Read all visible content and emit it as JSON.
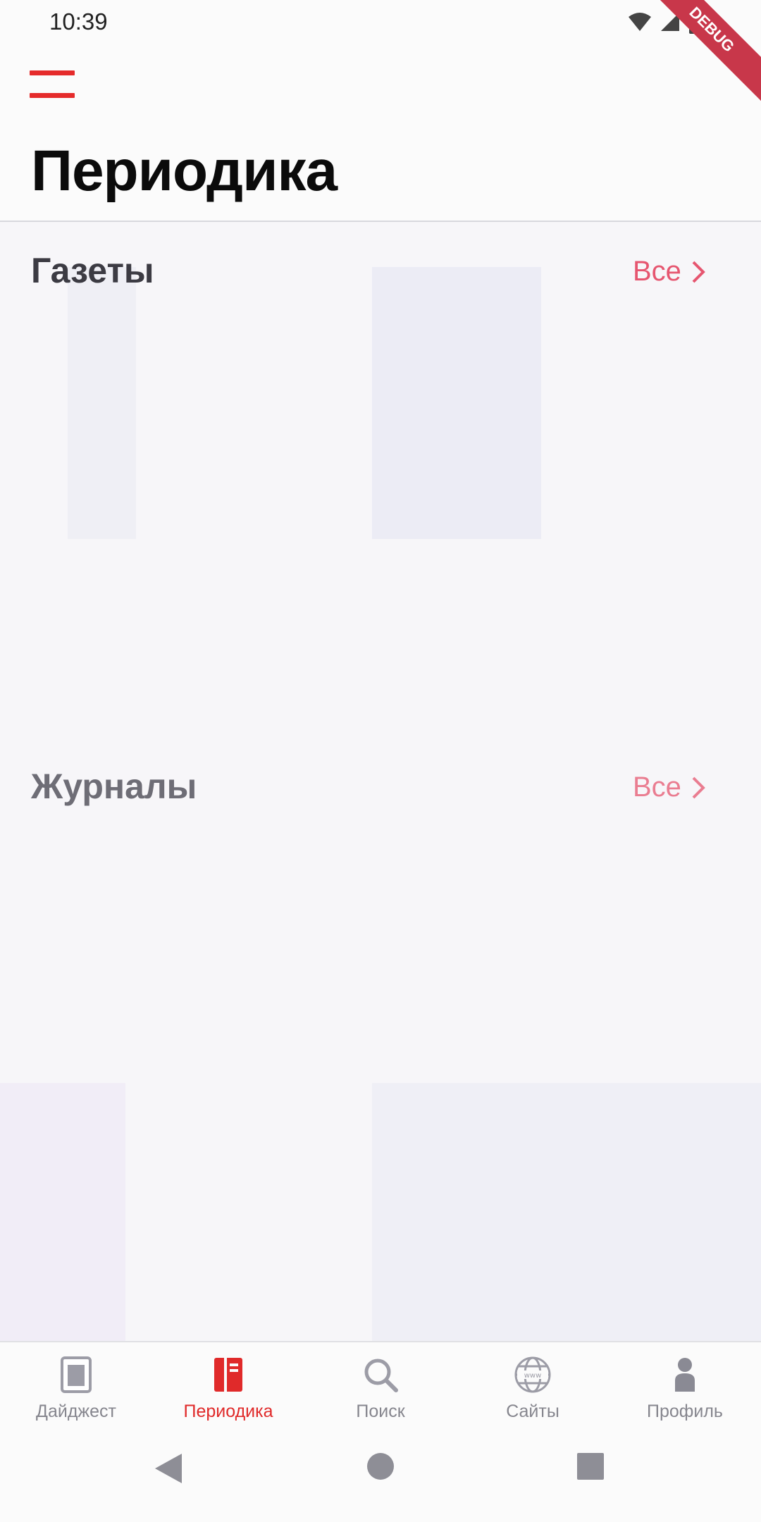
{
  "status_bar": {
    "time": "10:39",
    "debug_label": "DEBUG"
  },
  "header": {
    "menu_icon": "hamburger-icon",
    "title": "Периодика"
  },
  "sections": [
    {
      "title": "Газеты",
      "see_all": "Все"
    },
    {
      "title": "Журналы",
      "see_all": "Все"
    }
  ],
  "bottom_nav": {
    "items": [
      {
        "label": "Дайджест",
        "icon": "digest-icon"
      },
      {
        "label": "Периодика",
        "icon": "periodicals-icon",
        "active": true
      },
      {
        "label": "Поиск",
        "icon": "search-icon"
      },
      {
        "label": "Сайты",
        "icon": "globe-icon"
      },
      {
        "label": "Профиль",
        "icon": "profile-icon"
      }
    ]
  },
  "colors": {
    "accent": "#e02a2a",
    "link": "#e65670",
    "text": "#0b0b0b",
    "muted": "#86868e"
  }
}
